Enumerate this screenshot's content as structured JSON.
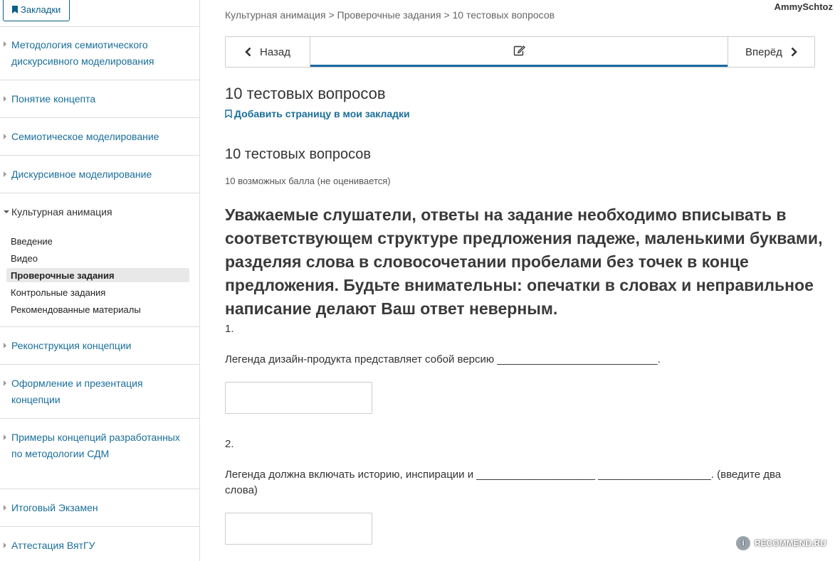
{
  "sidebar": {
    "bookmarks_label": "Закладки",
    "chapters": [
      {
        "label": "Методология семиотического дискурсивного моделирования"
      },
      {
        "label": "Понятие концепта"
      },
      {
        "label": "Семиотическое моделирование"
      },
      {
        "label": "Дискурсивное моделирование"
      },
      {
        "label": "Культурная анимация"
      },
      {
        "label": "Реконструкция концепции"
      },
      {
        "label": "Оформление и презентация концепции"
      },
      {
        "label": "Примеры концепций разработанных по методологии СДМ"
      },
      {
        "label": "Итоговый Экзамен"
      },
      {
        "label": "Аттестация ВятГУ"
      }
    ],
    "subsections": [
      {
        "label": "Введение"
      },
      {
        "label": "Видео"
      },
      {
        "label": "Проверочные задания"
      },
      {
        "label": "Контрольные задания"
      },
      {
        "label": "Рекомендованные материалы"
      }
    ]
  },
  "header": {
    "username": "AmmySchtoz",
    "breadcrumb": "Культурная анимация > Проверочные задания > 10 тестовых вопросов"
  },
  "seqnav": {
    "prev_label": "Назад",
    "next_label": "Вперёд",
    "current_icon": "edit-icon"
  },
  "main": {
    "title": "10 тестовых вопросов",
    "add_bookmark": "Добавить страницу в мои закладки",
    "problem_title": "10 тестовых вопросов",
    "points": "10 возможных балла (не оценивается)",
    "instructions": "Уважаемые слушатели, ответы на задание необходимо вписывать в соответствующем структуре предложения падеже, маленькими буквами, разделяя слова в словосочетании пробелами без точек в конце предложения. Будьте внимательны: опечатки в словах и неправильное написание делают Ваш ответ неверным.",
    "questions": [
      {
        "number": "1.",
        "text": "Легенда дизайн-продукта представляет собой версию ___________________________.",
        "value": ""
      },
      {
        "number": "2.",
        "text": "Легенда должна включать историю, инспирации и ____________________ ___________________. (введите два слова)",
        "value": ""
      }
    ]
  },
  "watermark": {
    "text": "RECOMMEND.RU"
  }
}
